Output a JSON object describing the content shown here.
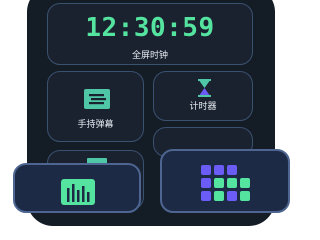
{
  "colors": {
    "background": "#ffffff",
    "phone_body": "#141c26",
    "card_fill": "#1a2230",
    "card_border": "#3b5170",
    "accent_green": "#55e4a0",
    "accent_teal": "#4fc7a6",
    "accent_purple": "#6b5cf6"
  },
  "clock_tile": {
    "time": "12:30:59",
    "label": "全屏时钟"
  },
  "tiles": [
    {
      "label": "手持弹幕",
      "icon": "message-board-icon"
    },
    {
      "label": "计时器",
      "icon": "hourglass-icon"
    }
  ],
  "dock_icons": [
    "sound-bars-icon",
    "app-grid-icon"
  ]
}
